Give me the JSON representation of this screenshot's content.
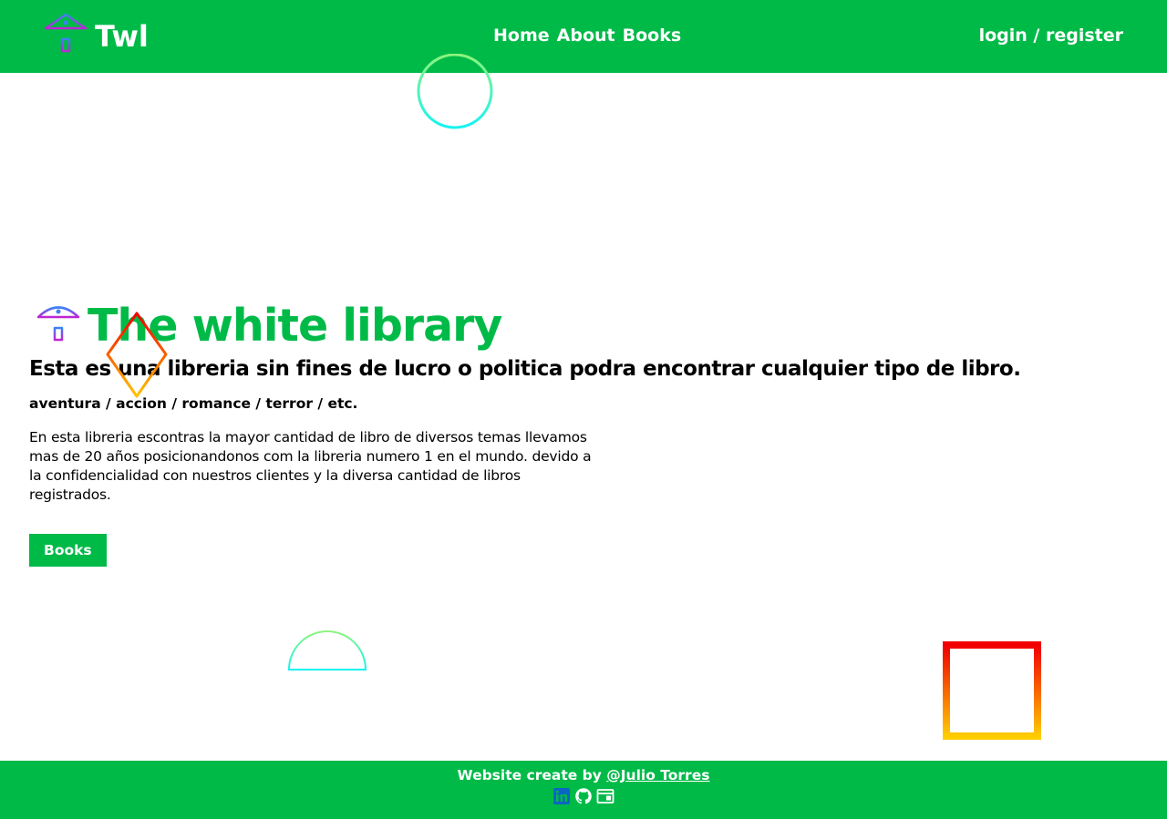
{
  "navbar": {
    "brand": "Twl",
    "links": [
      "Home",
      "About",
      "Books"
    ],
    "auth": "login / register",
    "brand_icon": "library-icon"
  },
  "hero": {
    "title": "The white library",
    "subtitle": "Esta es una libreria sin fines de lucro o politica podra encontrar cualquier tipo de libro.",
    "genres": "aventura / accion / romance / terror / etc.",
    "description": "En esta libreria escontras la mayor cantidad de libro de diversos temas llevamos mas de 20 años posicionandonos com la libreria numero 1 en el mundo. devido a la confidencialidad con nuestros clientes y la diversa cantidad de libros registrados.",
    "button": "Books",
    "icon": "library-icon"
  },
  "footer": {
    "credit_prefix": "Website create by",
    "credit_link": "@Julio Torres",
    "icons": [
      "linkedin-icon",
      "github-icon",
      "portfolio-icon"
    ]
  },
  "colors": {
    "brand_green": "#00ba48",
    "text": "#000000",
    "white": "#ffffff"
  }
}
